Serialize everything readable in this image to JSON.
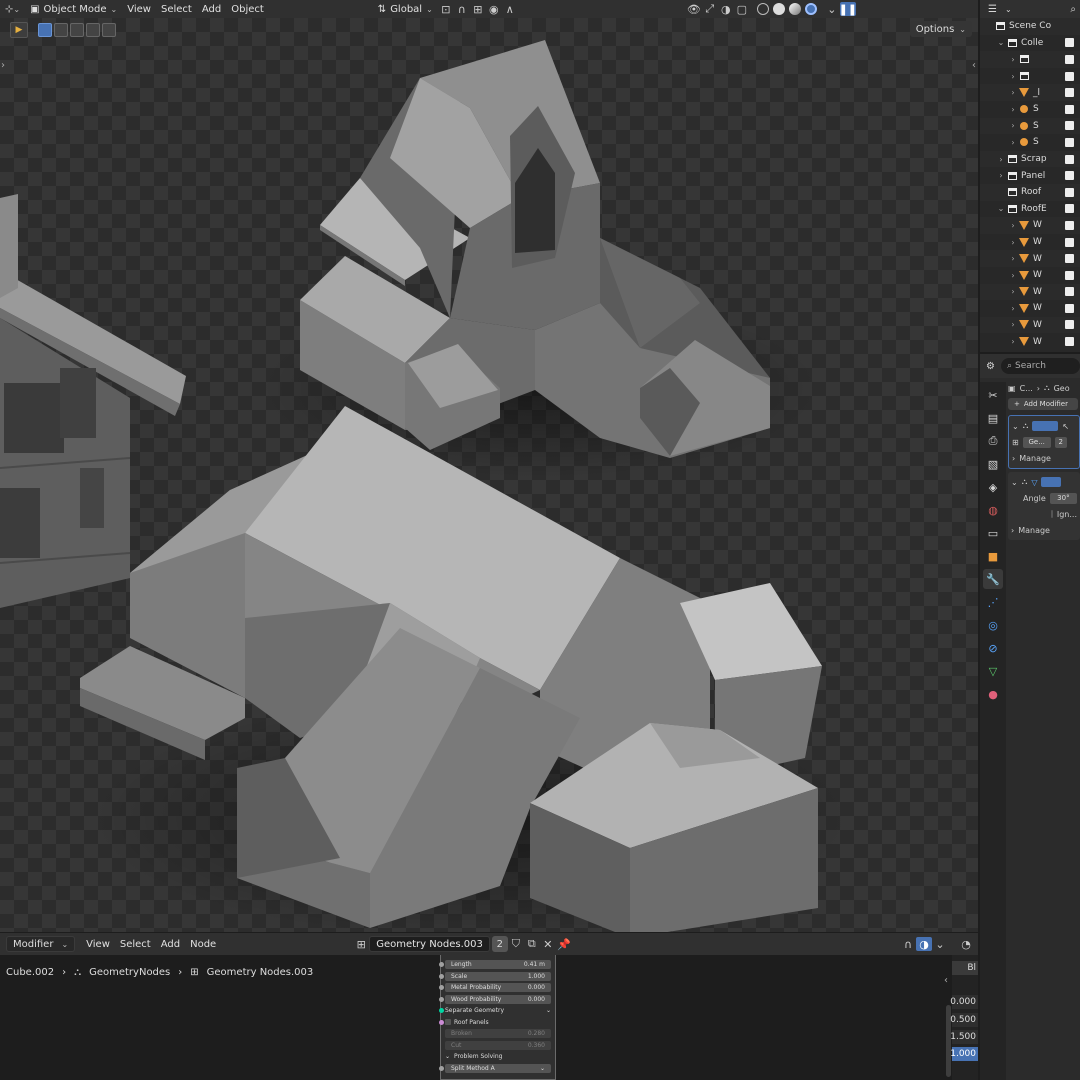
{
  "viewport_header": {
    "mode": "Object Mode",
    "menus": [
      "View",
      "Select",
      "Add",
      "Object"
    ],
    "orientation": "Global"
  },
  "viewport": {
    "options_label": "Options"
  },
  "outliner": {
    "rows": [
      {
        "label": "Scene Co",
        "type": "scene",
        "indent": 0,
        "expander": ""
      },
      {
        "label": "Colle",
        "type": "collection",
        "indent": 1,
        "expander": "⌄"
      },
      {
        "label": "",
        "type": "collection",
        "indent": 2,
        "expander": "›"
      },
      {
        "label": "",
        "type": "collection",
        "indent": 2,
        "expander": "›"
      },
      {
        "label": "_l",
        "type": "mesh",
        "indent": 2,
        "expander": "›"
      },
      {
        "label": "S",
        "type": "light",
        "indent": 2,
        "expander": "›"
      },
      {
        "label": "S",
        "type": "light",
        "indent": 2,
        "expander": "›"
      },
      {
        "label": "S",
        "type": "light",
        "indent": 2,
        "expander": "›"
      },
      {
        "label": "Scrap",
        "type": "collection",
        "indent": 1,
        "expander": "›"
      },
      {
        "label": "Panel",
        "type": "collection",
        "indent": 1,
        "expander": "›"
      },
      {
        "label": "Roof",
        "type": "collection",
        "indent": 1,
        "expander": ""
      },
      {
        "label": "RoofE",
        "type": "collection",
        "indent": 1,
        "expander": "⌄"
      },
      {
        "label": "W",
        "type": "mesh",
        "indent": 2,
        "expander": "›"
      },
      {
        "label": "W",
        "type": "mesh",
        "indent": 2,
        "expander": "›"
      },
      {
        "label": "W",
        "type": "mesh",
        "indent": 2,
        "expander": "›"
      },
      {
        "label": "W",
        "type": "mesh",
        "indent": 2,
        "expander": "›"
      },
      {
        "label": "W",
        "type": "mesh",
        "indent": 2,
        "expander": "›"
      },
      {
        "label": "W",
        "type": "mesh",
        "indent": 2,
        "expander": "›"
      },
      {
        "label": "W",
        "type": "mesh",
        "indent": 2,
        "expander": "›"
      },
      {
        "label": "W",
        "type": "mesh",
        "indent": 2,
        "expander": "›"
      }
    ]
  },
  "properties": {
    "search_placeholder": "Search",
    "breadcrumb": [
      "C...",
      "Geo"
    ],
    "add_modifier": "Add Modifier",
    "mod1_name": "Ge...",
    "mod1_users": "2",
    "manage_1": "Manage",
    "angle_label": "Angle",
    "angle_value": "30°",
    "ignore_label": "Ign...",
    "manage_2": "Manage"
  },
  "node_header": {
    "editor_type": "Modifier",
    "menus": [
      "View",
      "Select",
      "Add",
      "Node"
    ],
    "tree_name": "Geometry Nodes.003",
    "users": "2"
  },
  "node_breadcrumb": {
    "object": "Cube.002",
    "modifier": "GeometryNodes",
    "tree": "Geometry Nodes.003"
  },
  "node_card": {
    "fields": [
      {
        "label": "Length",
        "value": "0.41 m"
      },
      {
        "label": "Scale",
        "value": "1.000"
      },
      {
        "label": "Metal Probability",
        "value": "0.000"
      },
      {
        "label": "Wood Probability",
        "value": "0.000"
      }
    ],
    "separate_geometry": "Separate Geometry",
    "roof_panels": "Roof Panels",
    "broken_label": "Broken",
    "broken_value": "0.280",
    "cut_label": "Cut",
    "cut_value": "0.360",
    "problem_solving": "Problem Solving",
    "split_method": "Split Method A"
  },
  "side_panel": {
    "tab_label": "Bl",
    "values": [
      "0.000",
      "0.500",
      "1.500",
      "1.000"
    ]
  }
}
